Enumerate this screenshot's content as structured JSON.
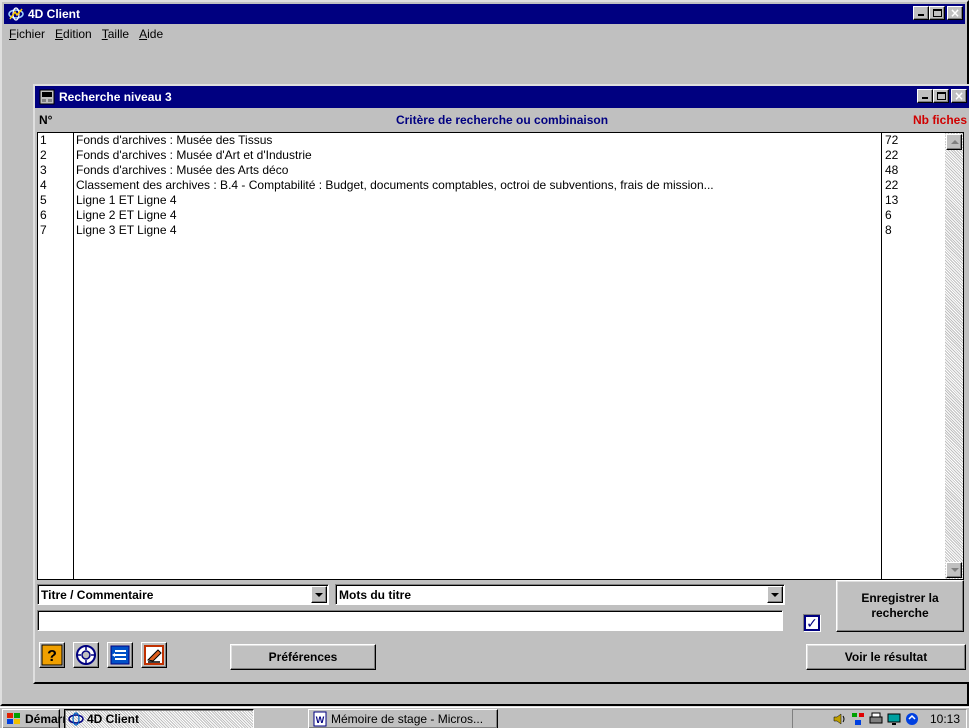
{
  "app": {
    "title": "4D Client",
    "menu": [
      "Fichier",
      "Edition",
      "Taille",
      "Aide"
    ]
  },
  "window": {
    "title": "Recherche niveau 3",
    "header": {
      "num": "N°",
      "criteria": "Critère de recherche ou combinaison",
      "count": "Nb fiches"
    },
    "rows": [
      {
        "n": "1",
        "criteria": "Fonds d'archives : Musée des Tissus",
        "count": "72"
      },
      {
        "n": "2",
        "criteria": "Fonds d'archives : Musée d'Art et d'Industrie",
        "count": "22"
      },
      {
        "n": "3",
        "criteria": "Fonds d'archives : Musée des Arts déco",
        "count": "48"
      },
      {
        "n": "4",
        "criteria": "Classement des archives : B.4 - Comptabilité : Budget, documents comptables, octroi de subventions, frais de mission...",
        "count": "22"
      },
      {
        "n": "5",
        "criteria": "Ligne 1  ET  Ligne 4",
        "count": "13"
      },
      {
        "n": "6",
        "criteria": "Ligne 2  ET  Ligne 4",
        "count": "6"
      },
      {
        "n": "7",
        "criteria": "Ligne 3  ET  Ligne 4",
        "count": "8"
      }
    ],
    "field_select": "Titre / Commentaire",
    "operator_select": "Mots du titre",
    "search_value": "",
    "checkbox_checked": true,
    "buttons": {
      "save_search": "Enregistrer la recherche",
      "preferences": "Préférences",
      "view_result": "Voir le résultat"
    },
    "toolbar_icons": [
      "help-icon",
      "target-icon",
      "list-icon",
      "eraser-icon"
    ]
  },
  "taskbar": {
    "start": "Démarrer",
    "tasks": [
      {
        "label": "4D Client",
        "active": true
      },
      {
        "label": "Mémoire de stage - Micros...",
        "active": false
      }
    ],
    "clock": "10:13",
    "tray_icons": [
      "speaker-icon",
      "network-icon",
      "printer-icon",
      "monitor-icon",
      "sync-icon"
    ]
  },
  "colors": {
    "title_bar": "#000080",
    "header_criteria": "#000080",
    "header_count": "#d00000"
  }
}
